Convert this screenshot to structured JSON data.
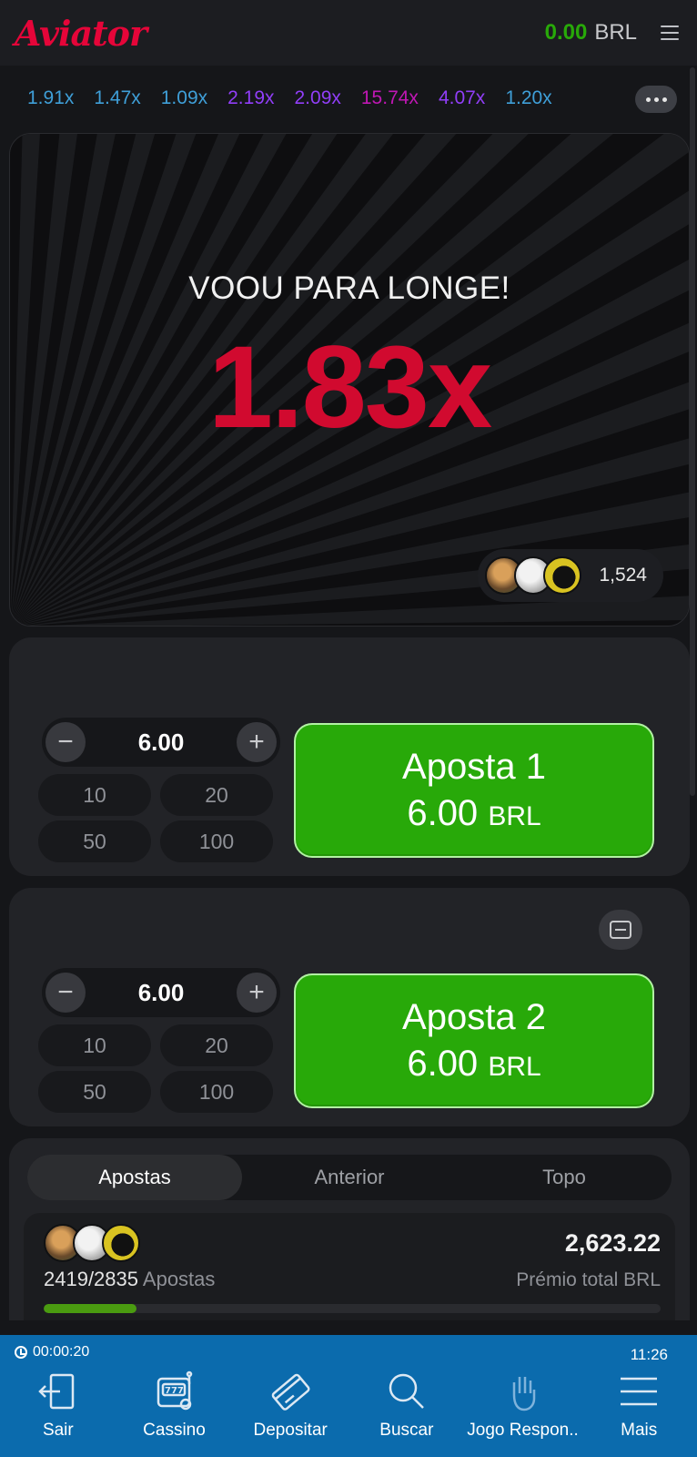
{
  "header": {
    "logo": "Aviator",
    "balance_amount": "0.00",
    "balance_currency": "BRL",
    "menu_icon": "hamburger-icon"
  },
  "history": [
    {
      "value": "1.91x",
      "color": "#3f9fd8"
    },
    {
      "value": "1.47x",
      "color": "#3f9fd8"
    },
    {
      "value": "1.09x",
      "color": "#3f9fd8"
    },
    {
      "value": "2.19x",
      "color": "#913ef8"
    },
    {
      "value": "2.09x",
      "color": "#913ef8"
    },
    {
      "value": "15.74x",
      "color": "#c017b4"
    },
    {
      "value": "4.07x",
      "color": "#913ef8"
    },
    {
      "value": "1.20x",
      "color": "#3f9fd8"
    }
  ],
  "game": {
    "status_text": "VOOU PARA LONGE!",
    "multiplier": "1.83x",
    "players_count": "1,524"
  },
  "bets": [
    {
      "amount": "6.00",
      "quick": [
        "10",
        "20",
        "50",
        "100"
      ],
      "button_title": "Aposta 1",
      "button_amount": "6.00",
      "button_currency": "BRL"
    },
    {
      "amount": "6.00",
      "quick": [
        "10",
        "20",
        "50",
        "100"
      ],
      "button_title": "Aposta 2",
      "button_amount": "6.00",
      "button_currency": "BRL"
    }
  ],
  "list": {
    "tabs": [
      "Apostas",
      "Anterior",
      "Topo"
    ],
    "bets_count": "2419/2835",
    "bets_label": "Apostas",
    "total_prize": "2,623.22",
    "total_label": "Prémio total BRL",
    "progress_fraction": 0.15
  },
  "bottom_nav": {
    "timer": "00:00:20",
    "clock": "11:26",
    "items": [
      "Sair",
      "Cassino",
      "Depositar",
      "Buscar",
      "Jogo Respon..",
      "Mais"
    ]
  },
  "colors": {
    "accent_red": "#e50539",
    "balance_green": "#28a909",
    "bet_green": "#28a909",
    "nav_blue": "#0b6bad"
  }
}
